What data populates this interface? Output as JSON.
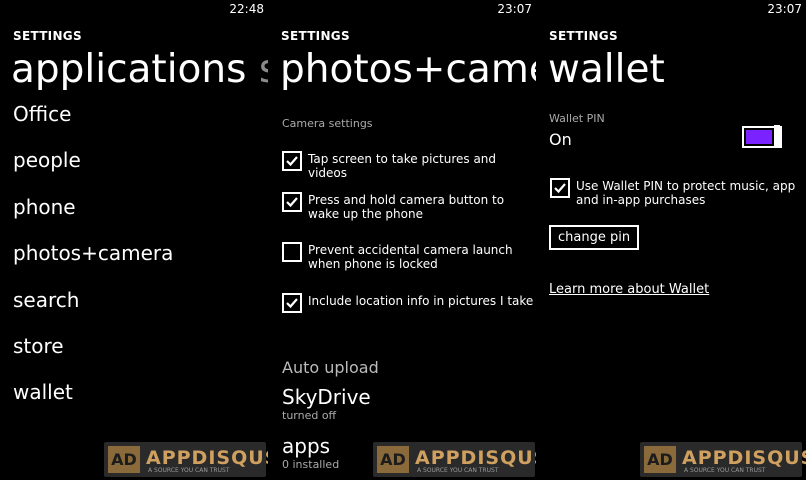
{
  "panels": [
    {
      "time": "22:48",
      "header": "SETTINGS",
      "title": "applications",
      "title_next": "sys",
      "items": [
        "Office",
        "people",
        "phone",
        "photos+camera",
        "search",
        "store",
        "wallet"
      ]
    },
    {
      "time": "23:07",
      "header": "SETTINGS",
      "title": "photos+camera",
      "section_label": "Camera settings",
      "checkboxes": [
        {
          "label": "Tap screen to take pictures and videos",
          "checked": true
        },
        {
          "label": "Press and hold camera button to wake up the phone",
          "checked": true
        },
        {
          "label": "Prevent accidental camera launch when phone is locked",
          "checked": false
        },
        {
          "label": "Include location info in pictures I take",
          "checked": true
        }
      ],
      "auto_upload_label": "Auto upload",
      "skydrive": {
        "title": "SkyDrive",
        "status": "turned off"
      },
      "apps": {
        "title": "apps",
        "status": "0 installed"
      }
    },
    {
      "time": "23:07",
      "header": "SETTINGS",
      "title": "wallet",
      "pin_label": "Wallet PIN",
      "pin_state": "On",
      "pin_checkbox": {
        "label": "Use Wallet PIN to protect music, app and in-app purchases",
        "checked": true
      },
      "change_pin_button": "change pin",
      "learn_more_link": "Learn more about Wallet"
    }
  ],
  "watermark": {
    "logo": "AD",
    "text": "APPDISQUS",
    "sub": "A SOURCE YOU CAN TRUST"
  },
  "colors": {
    "background": "#000000",
    "text": "#ffffff",
    "accent": "#7a22ff"
  }
}
